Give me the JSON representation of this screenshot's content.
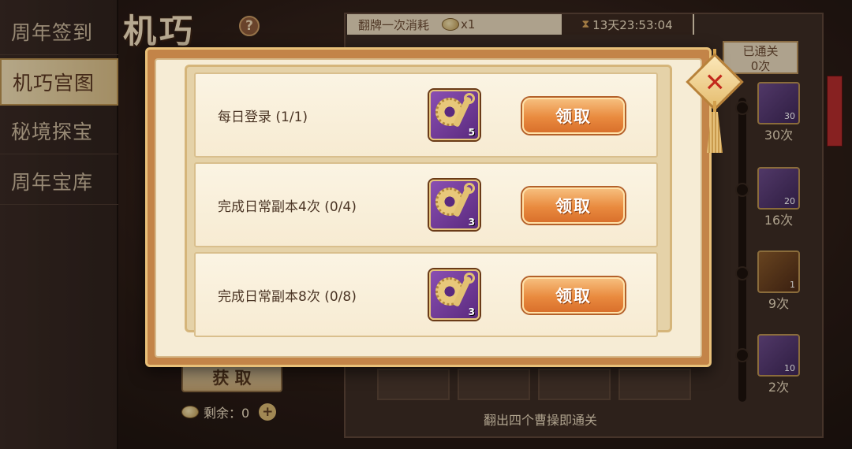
{
  "background": {
    "nav": [
      {
        "label": "周年签到",
        "active": false
      },
      {
        "label": "机巧宫图",
        "active": true
      },
      {
        "label": "秘境探宝",
        "active": false
      },
      {
        "label": "周年宝库",
        "active": false
      }
    ],
    "title": "机巧",
    "help": "?",
    "cost_label": "翻牌一次消耗",
    "cost_count": "x1",
    "timer": "13天23:53:04",
    "cleared_line1": "已通关",
    "cleared_line2": "0次",
    "milestones": [
      {
        "count": "30",
        "label": "30次"
      },
      {
        "count": "20",
        "label": "16次"
      },
      {
        "count": "1",
        "label": "9次"
      },
      {
        "count": "10",
        "label": "2次"
      }
    ],
    "get_button": "获 取",
    "remaining": "剩余：0",
    "bottom_hint": "翻出四个曹操即通关"
  },
  "modal": {
    "tasks": [
      {
        "title": "每日登录 (1/1)",
        "reward_count": "5",
        "button": "领取"
      },
      {
        "title": "完成日常副本4次 (0/4)",
        "reward_count": "3",
        "button": "领取"
      },
      {
        "title": "完成日常副本8次 (0/8)",
        "reward_count": "3",
        "button": "领取"
      }
    ],
    "close_icon": "close-icon"
  },
  "colors": {
    "accent_orange": "#e98a3e",
    "frame": "#c38448",
    "panel": "#f6ecd5",
    "close_red": "#c2281c"
  }
}
